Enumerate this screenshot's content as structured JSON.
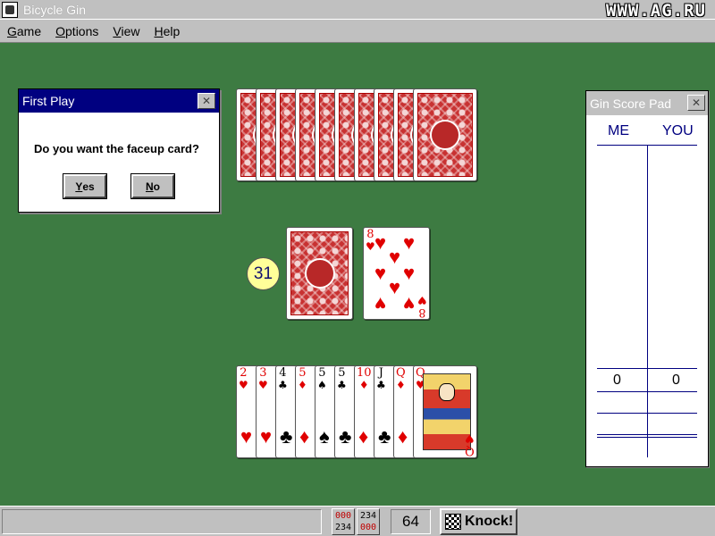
{
  "window": {
    "title": "Bicycle Gin",
    "watermark": "WWW.AG.RU"
  },
  "menu": [
    {
      "label": "Game",
      "acc": "G",
      "rest": "ame"
    },
    {
      "label": "Options",
      "acc": "O",
      "rest": "ptions"
    },
    {
      "label": "View",
      "acc": "V",
      "rest": "iew"
    },
    {
      "label": "Help",
      "acc": "H",
      "rest": "elp"
    }
  ],
  "dialog": {
    "title": "First Play",
    "close_glyph": "✕",
    "question": "Do you want the faceup card?",
    "yes": {
      "acc": "Y",
      "rest": "es"
    },
    "no": {
      "acc": "N",
      "rest": "o"
    }
  },
  "opponent_hand": {
    "card_count": 10,
    "face": "down"
  },
  "stock": {
    "remaining": "31"
  },
  "discard": {
    "rank": "8",
    "suit": "♥",
    "color": "#e00000"
  },
  "player_hand": [
    {
      "rank": "2",
      "suit": "♥",
      "color": "red"
    },
    {
      "rank": "3",
      "suit": "♥",
      "color": "red"
    },
    {
      "rank": "4",
      "suit": "♣",
      "color": "black"
    },
    {
      "rank": "5",
      "suit": "♦",
      "color": "red"
    },
    {
      "rank": "5",
      "suit": "♠",
      "color": "black"
    },
    {
      "rank": "5",
      "suit": "♣",
      "color": "black"
    },
    {
      "rank": "10",
      "suit": "♦",
      "color": "red"
    },
    {
      "rank": "J",
      "suit": "♣",
      "color": "black"
    },
    {
      "rank": "Q",
      "suit": "♦",
      "color": "red"
    },
    {
      "rank": "Q",
      "suit": "♥",
      "color": "red"
    }
  ],
  "score_pad": {
    "title": "Gin Score Pad",
    "close_glyph": "✕",
    "col_me": "ME",
    "col_you": "YOU",
    "score_me": "0",
    "score_you": "0"
  },
  "status": {
    "message": "",
    "sort_rank": {
      "top": "000",
      "bottom": "234"
    },
    "sort_suit": {
      "top": "234",
      "bottom": "000"
    },
    "points": "64",
    "knock_label": "Knock!"
  },
  "colors": {
    "felt": "#3d7b42",
    "title_active": "#000080",
    "card_back": "#c83232"
  }
}
